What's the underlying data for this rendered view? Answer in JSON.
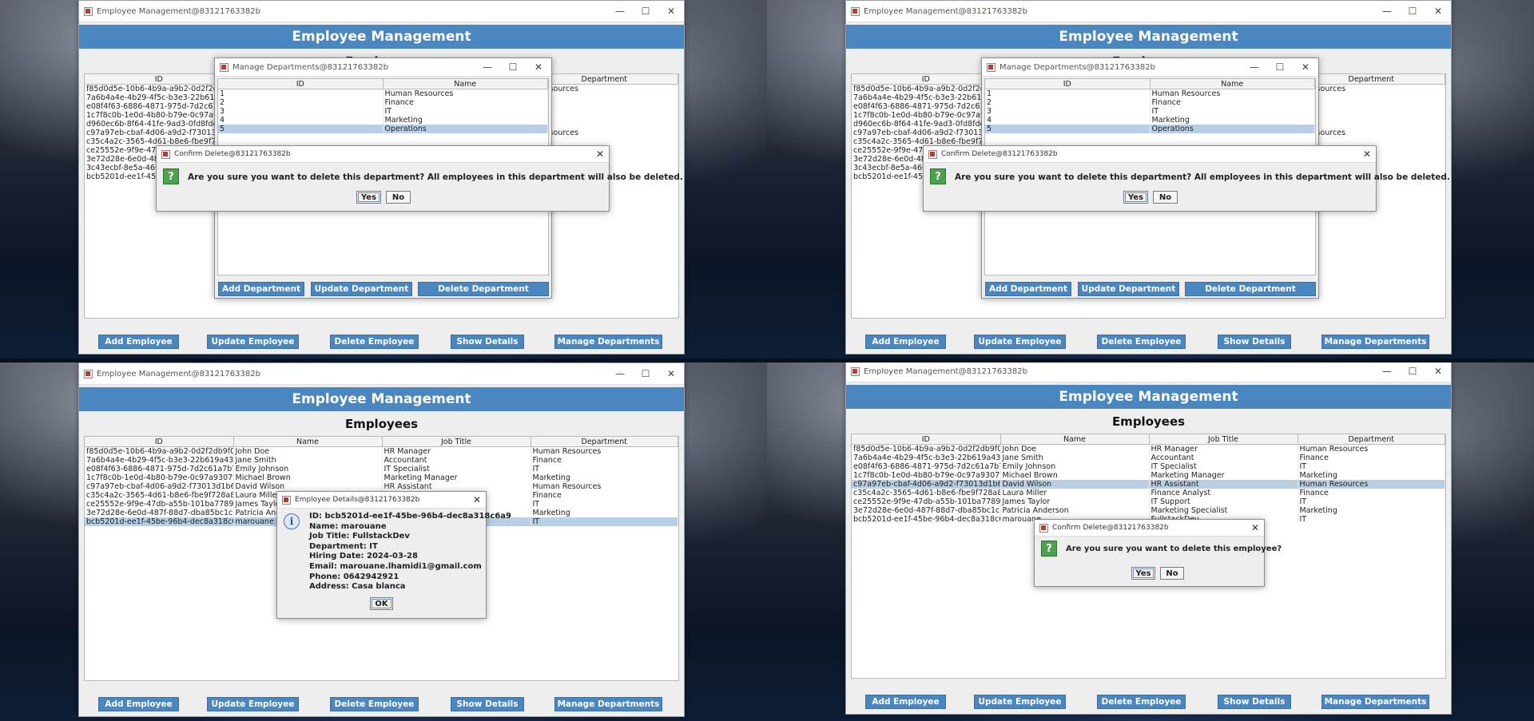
{
  "app": {
    "window_title": "Employee Management@83121763382b",
    "banner": "Employee Management",
    "heading": "Employees",
    "window_controls": {
      "minimize": "—",
      "maximize": "☐",
      "close": "✕"
    }
  },
  "table": {
    "columns": [
      "ID",
      "Name",
      "Job Title",
      "Department"
    ],
    "rows": [
      {
        "id": "f85d0d5e-10b6-4b9a-a9b2-0d2f2db9f088",
        "name": "John Doe",
        "job": "HR Manager",
        "dept": "Human Resources"
      },
      {
        "id": "7a6b4a4e-4b29-4f5c-b3e3-22b619a43...",
        "name": "Jane Smith",
        "job": "Accountant",
        "dept": "Finance"
      },
      {
        "id": "e08f4f63-6886-4871-975d-7d2c61a7b7...",
        "name": "Emily Johnson",
        "job": "IT Specialist",
        "dept": "IT"
      },
      {
        "id": "1c7f8c0b-1e0d-4b80-b79e-0c97a9307ff9",
        "name": "Michael Brown",
        "job": "Marketing Manager",
        "dept": "Marketing"
      },
      {
        "id": "c97a97eb-cbaf-4d06-a9d2-f73013d1b6...",
        "name": "David Wilson",
        "job": "HR Assistant",
        "dept": "Human Resources"
      },
      {
        "id": "c35c4a2c-3565-4d61-b8e6-fbe9f728a86d",
        "name": "Laura Miller",
        "job": "Finance Analyst",
        "dept": "Finance"
      },
      {
        "id": "ce25552e-9f9e-47db-a55b-101ba7789f...",
        "name": "James Taylor",
        "job": "IT Support",
        "dept": "IT"
      },
      {
        "id": "3e72d28e-6e0d-487f-88d7-dba85bc1c...",
        "name": "Patricia Anderson",
        "job": "Marketing Specialist",
        "dept": "Marketing"
      },
      {
        "id": "bcb5201d-ee1f-45be-96b4-dec8a318c6...",
        "name": "marouane",
        "job": "FullstackDev",
        "dept": "IT"
      }
    ]
  },
  "q1_dept_ids_visible": [
    "f85d0d5e-10b6-4b9a-a9b2-0d2f2db9",
    "7a6b4a4e-4b29-4f5c-b3e3-22b619a",
    "e08f4f63-6886-4871-975d-7d2c61a7",
    "1c7f8c0b-1e0d-4b80-b79e-0c97a930",
    "d960ec6b-8f64-41fe-9ad3-0fd8fdd7",
    "c97a97eb-cbaf-4d06-a9d2-f73013d1",
    "c35c4a2c-3565-4d61-b8e6-fbe9f728",
    "ce25552e-9f9e-47d",
    "3e72d28e-6e0d-487",
    "3c43ecbf-8e5a-4668",
    "bcb5201d-ee1f-45bd"
  ],
  "q1_dept_tail": [
    "n Resources",
    "e",
    "",
    "ting",
    "tions",
    "n Resources",
    "e",
    "",
    "",
    "",
    ""
  ],
  "buttons": {
    "add_employee": "Add Employee",
    "update_employee": "Update Employee",
    "delete_employee": "Delete Employee",
    "show_details": "Show Details",
    "manage_departments": "Manage Departments"
  },
  "manage_departments": {
    "title": "Manage Departments@83121763382b",
    "columns": [
      "ID",
      "Name"
    ],
    "rows": [
      {
        "id": "1",
        "name": "Human Resources"
      },
      {
        "id": "2",
        "name": "Finance"
      },
      {
        "id": "3",
        "name": "IT"
      },
      {
        "id": "4",
        "name": "Marketing"
      },
      {
        "id": "5",
        "name": "Operations"
      }
    ],
    "add": "Add Department",
    "update": "Update Department",
    "delete": "Delete Department"
  },
  "confirm_dept": {
    "title": "Confirm Delete@83121763382b",
    "message": "Are you sure you want to delete this department? All employees in this department will also be deleted.",
    "yes": "Yes",
    "no": "No"
  },
  "details_dialog": {
    "title": "Employee Details@83121763382b",
    "lines": [
      "ID: bcb5201d-ee1f-45be-96b4-dec8a318c6a9",
      "Name: marouane",
      "Job Title: FullstackDev",
      "Department: IT",
      "Hiring Date: 2024-03-28",
      "Email: marouane.lhamidi1@gmail.com",
      "Phone: 0642942921",
      "Address: Casa blanca"
    ],
    "ok": "OK"
  },
  "confirm_emp": {
    "title": "Confirm Delete@83121763382b",
    "message": "Are you sure you want to delete this employee?",
    "yes": "Yes",
    "no": "No"
  },
  "colors": {
    "accent": "#4a87c0",
    "selection": "#b8cfe5",
    "question_icon": "#4ea24e"
  }
}
